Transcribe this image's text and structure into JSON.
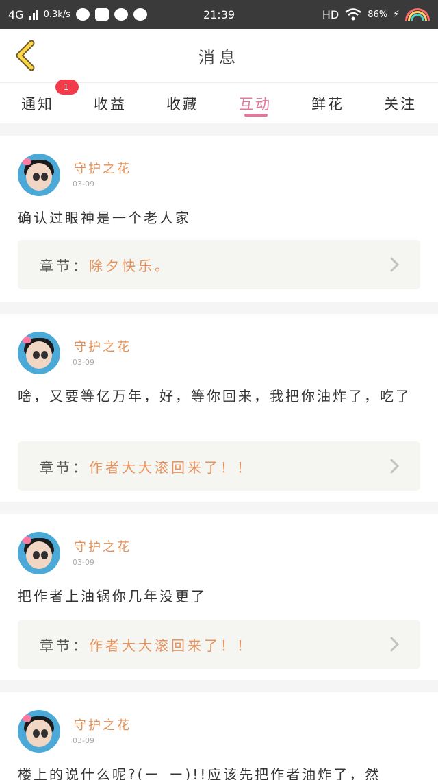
{
  "status_bar": {
    "network": "4G",
    "speed": "0.3k/s",
    "time": "21:39",
    "hd": "HD",
    "battery": "86%"
  },
  "header": {
    "title": "消息",
    "back_icon": "chevron-left-icon"
  },
  "tabs": [
    {
      "label": "通知",
      "badge": "1"
    },
    {
      "label": "收益"
    },
    {
      "label": "收藏"
    },
    {
      "label": "互动",
      "active": true
    },
    {
      "label": "鲜花"
    },
    {
      "label": "关注"
    }
  ],
  "cards": [
    {
      "name": "守护之花",
      "date": "03-09",
      "content": "确认过眼神是一个老人家",
      "chapter_label": "章节：",
      "chapter_title": "除夕快乐。"
    },
    {
      "name": "守护之花",
      "date": "03-09",
      "content": "啥，又要等亿万年，好，等你回来，我把你油炸了，吃了",
      "chapter_label": "章节：",
      "chapter_title": "作者大大滚回来了！！"
    },
    {
      "name": "守护之花",
      "date": "03-09",
      "content": "把作者上油锅你几年没更了",
      "chapter_label": "章节：",
      "chapter_title": "作者大大滚回来了！！"
    },
    {
      "name": "守护之花",
      "date": "03-09",
      "content": "楼上的说什么呢?(ー_ー)!!应该先把作者油炸了，然"
    }
  ],
  "colors": {
    "accent": "#e07a9b",
    "name": "#e39157",
    "badge": "#f23c4b"
  }
}
